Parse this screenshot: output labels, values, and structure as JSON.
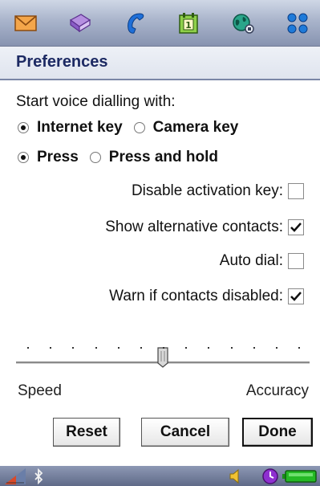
{
  "topbar": {
    "icons": [
      "messaging-icon",
      "contacts-book-icon",
      "phone-handset-icon",
      "calendar-icon",
      "internet-globe-icon",
      "apps-menu-icon"
    ]
  },
  "page": {
    "title": "Preferences"
  },
  "form": {
    "start_label": "Start voice dialling with:",
    "key_option_1": "Internet key",
    "key_option_2": "Camera key",
    "press_option_1": "Press",
    "press_option_2": "Press and hold",
    "selected_key": "Internet key",
    "selected_press": "Press",
    "checks": [
      {
        "label": "Disable activation key:",
        "checked": false
      },
      {
        "label": "Show alternative contacts:",
        "checked": true
      },
      {
        "label": "Auto dial:",
        "checked": false
      },
      {
        "label": "Warn if contacts disabled:",
        "checked": true
      }
    ]
  },
  "slider": {
    "min_label": "Speed",
    "max_label": "Accuracy",
    "value_fraction": 0.5,
    "tick_count": 13
  },
  "buttons": {
    "reset": "Reset",
    "cancel": "Cancel",
    "done": "Done"
  },
  "status": {
    "signal": "signal-strength-icon",
    "bluetooth": "bluetooth-icon",
    "volume": "speaker-icon",
    "clock": "clock-icon",
    "battery": "battery-icon"
  },
  "colors": {
    "title_text": "#1d2a63",
    "top_bar": "#a9b4cb",
    "status_bar": "#6f7a94"
  }
}
